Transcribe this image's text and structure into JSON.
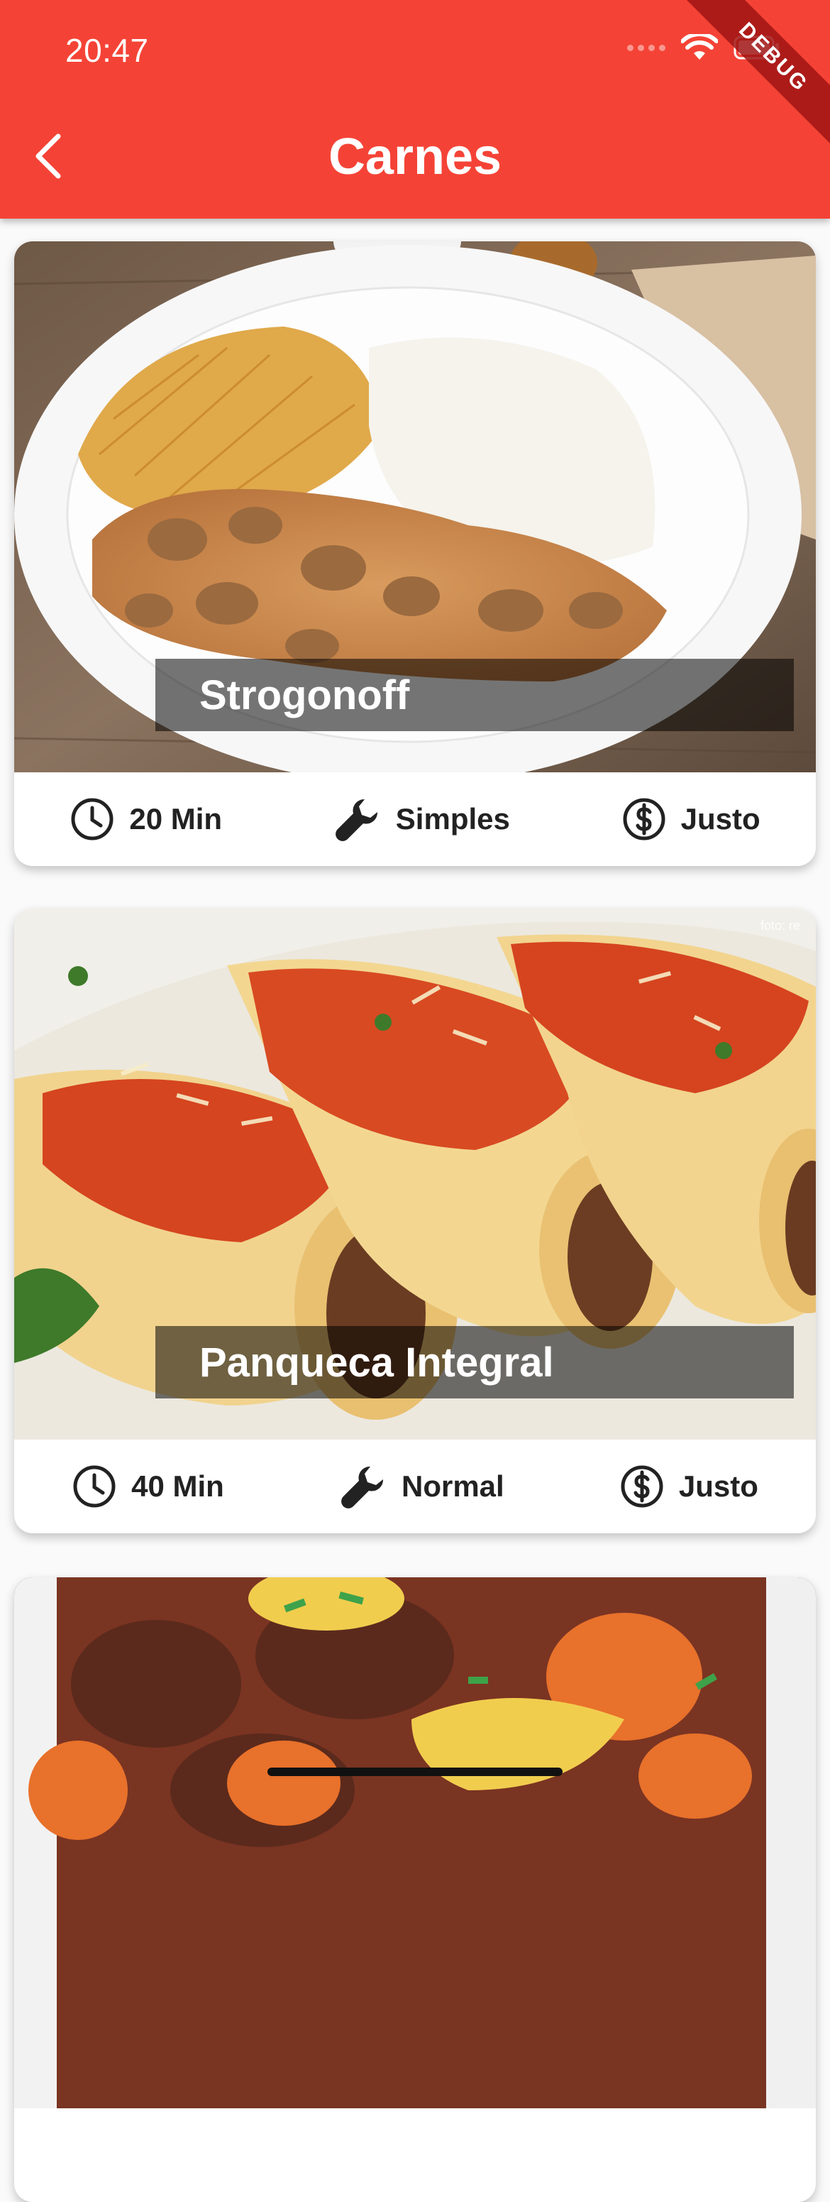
{
  "status_bar": {
    "time": "20:47",
    "icons": [
      "signal-icon",
      "wifi-icon",
      "battery-icon"
    ]
  },
  "debug_banner": "DEBUG",
  "app_bar": {
    "title": "Carnes",
    "back_icon": "chevron-left-icon",
    "background_color": "#f44336"
  },
  "meals": [
    {
      "title": "Strogonoff",
      "duration": "20 Min",
      "complexity": "Simples",
      "cost": "Justo"
    },
    {
      "title": "Panqueca Integral",
      "duration": "40 Min",
      "complexity": "Normal",
      "cost": "Justo"
    },
    {
      "title": "",
      "duration": "",
      "complexity": "",
      "cost": ""
    }
  ],
  "info_icons": {
    "duration": "clock-icon",
    "complexity": "wrench-icon",
    "cost": "dollar-circle-icon"
  }
}
